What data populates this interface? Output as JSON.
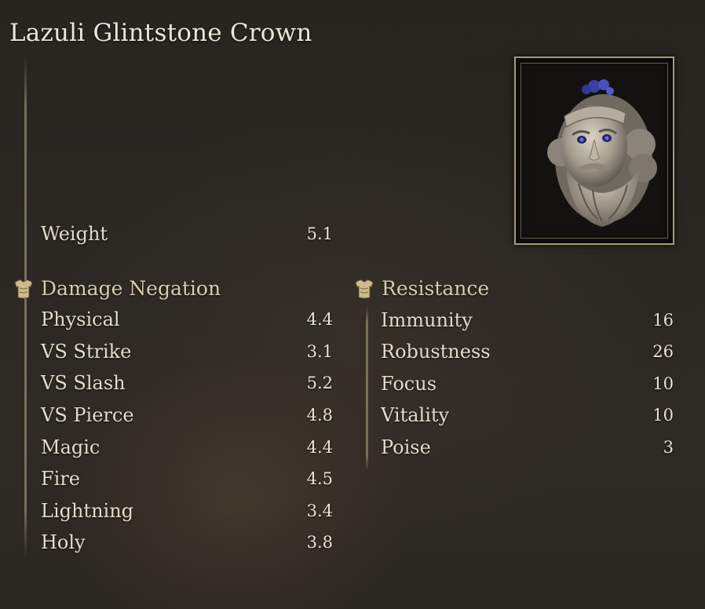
{
  "item": {
    "name": "Lazuli Glintstone Crown",
    "image_icon": "lazuli-glintstone-crown-icon"
  },
  "weight": {
    "label": "Weight",
    "value": "5.1"
  },
  "damage_negation": {
    "title": "Damage Negation",
    "icon": "armor-icon",
    "rows": [
      {
        "label": "Physical",
        "value": "4.4"
      },
      {
        "label": "VS Strike",
        "value": "3.1"
      },
      {
        "label": "VS Slash",
        "value": "5.2"
      },
      {
        "label": "VS Pierce",
        "value": "4.8"
      },
      {
        "label": "Magic",
        "value": "4.4"
      },
      {
        "label": "Fire",
        "value": "4.5"
      },
      {
        "label": "Lightning",
        "value": "3.4"
      },
      {
        "label": "Holy",
        "value": "3.8"
      }
    ]
  },
  "resistance": {
    "title": "Resistance",
    "icon": "armor-icon",
    "rows": [
      {
        "label": "Immunity",
        "value": "16"
      },
      {
        "label": "Robustness",
        "value": "26"
      },
      {
        "label": "Focus",
        "value": "10"
      },
      {
        "label": "Vitality",
        "value": "10"
      },
      {
        "label": "Poise",
        "value": "3"
      }
    ]
  },
  "colors": {
    "text": "#e3dccb",
    "section_title": "#d6ccb0",
    "frame": "#d7c8a0",
    "background": "#2b2823"
  }
}
